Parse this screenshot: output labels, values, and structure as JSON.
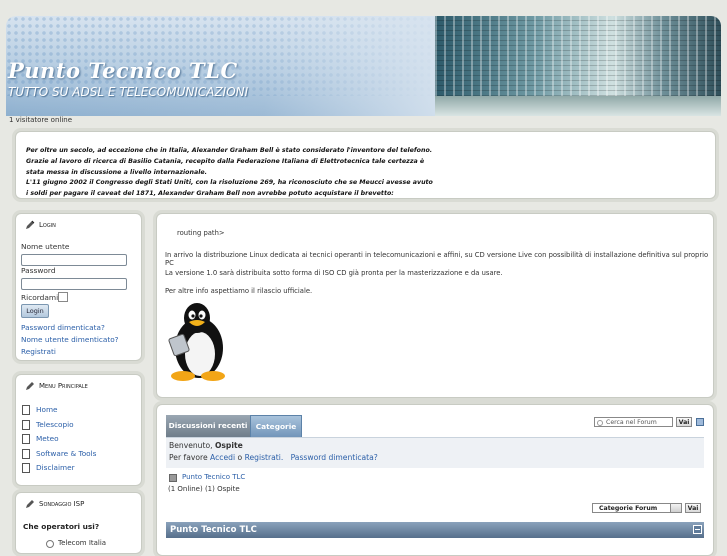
{
  "header": {
    "site_title": "Punto Tecnico TLC",
    "site_slogan": "TUTTO SU ADSL E TELECOMUNICAZIONI",
    "visitors": "1 visitatore online"
  },
  "intro": {
    "lines": [
      "Per oltre un secolo, ad eccezione che in Italia, Alexander Graham Bell è stato considerato l'inventore del telefono.",
      "Grazie al lavoro di ricerca di Basilio Catania, recepito dalla Federazione Italiana di Elettrotecnica tale certezza è",
      "stata messa in discussione a livello internazionale.",
      "L'11 giugno 2002 il Congresso degli Stati Uniti, con la risoluzione 269, ha riconosciuto che se Meucci avesse avuto",
      "i soldi per pagare il caveat del 1871, Alexander Graham Bell non avrebbe potuto acquistare il brevetto:"
    ]
  },
  "login": {
    "title": "Login",
    "name_label": "Nome utente",
    "name_value": "",
    "password_label": "Password",
    "password_value": "",
    "remember_label": "Ricordami",
    "button": "Login",
    "links": [
      "Password dimenticata?",
      "Nome utente dimenticato?",
      "Registrati"
    ]
  },
  "menu": {
    "title": "Menu Principale",
    "items": [
      "Home",
      "Telescopio",
      "Meteo",
      "Software & Tools",
      "Disclaimer"
    ]
  },
  "poll": {
    "title": "Sondaggio ISP",
    "question": "Che operatori usi?",
    "first_option": "Telecom Italia"
  },
  "main": {
    "routing": "routing path>",
    "p1": "In arrivo la distribuzione Linux dedicata ai tecnici operanti in telecomunicazioni e affini, su CD versione Live con possibilità di installazione definitiva sul proprio PC",
    "p2": "La versione 1.0 sarà distribuita sotto forma di ISO CD già pronta per la masterizzazione e da usare.",
    "p3": "Per altre info aspettiamo il rilascio ufficiale."
  },
  "forum": {
    "tabs": [
      "Discussioni recenti",
      "Categorie"
    ],
    "search_placeholder": "Cerca nel Forum",
    "go": "Vai",
    "welcome": "Benvenuto,",
    "guest": "Ospite",
    "please": "Per favore",
    "access": "Accedi",
    "or": "o",
    "register": "Registrati.",
    "forgot": "Password dimenticata?",
    "forum_link": "Punto Tecnico TLC",
    "online": "(1 Online) (1) Ospite",
    "category_select": "Categorie Forum",
    "go2": "Vai",
    "section_title": "Punto Tecnico TLC"
  },
  "colors": {
    "link": "#2b5fa8",
    "section_bar": "#566f8b",
    "page_bg": "#e7e8e3"
  }
}
